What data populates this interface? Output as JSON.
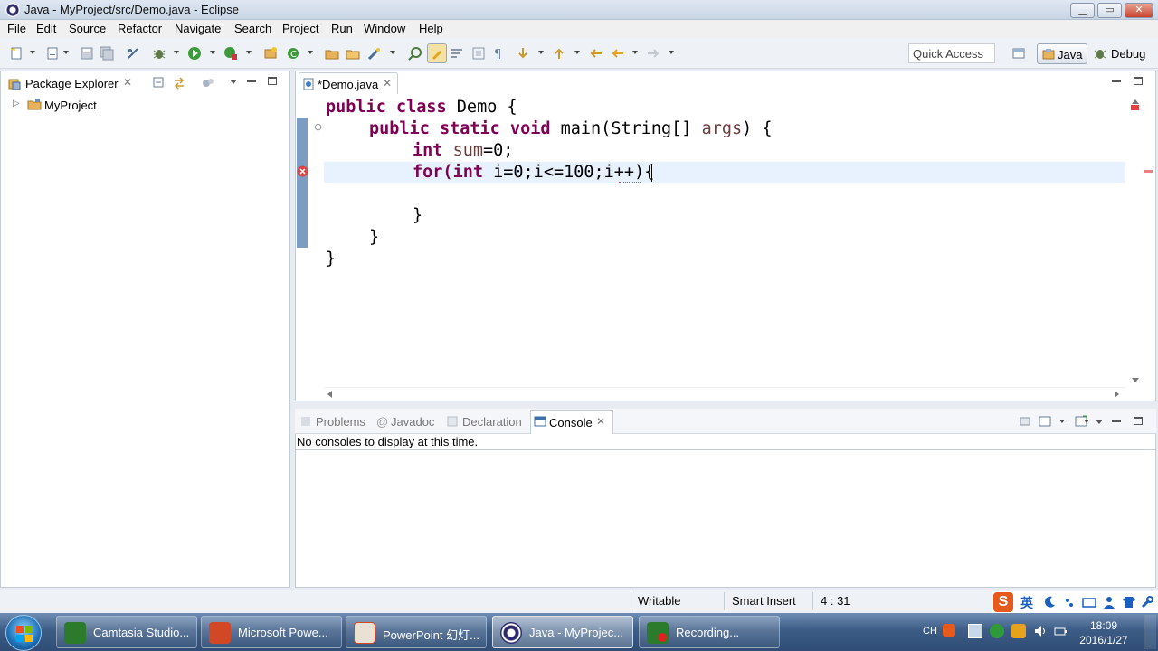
{
  "window": {
    "title": "Java - MyProject/src/Demo.java - Eclipse",
    "minimize": "▁",
    "maximize": "▭",
    "close": "✕"
  },
  "menu": [
    "File",
    "Edit",
    "Source",
    "Refactor",
    "Navigate",
    "Search",
    "Project",
    "Run",
    "Window",
    "Help"
  ],
  "toolbar": {
    "quick_access": "Quick Access",
    "perspective_java": "Java",
    "perspective_debug": "Debug"
  },
  "package_explorer": {
    "title": "Package Explorer",
    "close": "✕",
    "project": "MyProject",
    "expand": "▷"
  },
  "editor": {
    "tab_label": "*Demo.java",
    "close": "✕",
    "code_lines": [
      [
        "public class ",
        "Demo {"
      ],
      [
        "public static void ",
        "main(String[] ",
        "args",
        ") {"
      ],
      [
        "int ",
        "sum",
        "=0;"
      ],
      [
        "for(",
        "int ",
        "i=0;i<=100;i++){"
      ],
      [
        "}"
      ],
      [
        "}"
      ],
      [
        "}"
      ]
    ]
  },
  "bottom_panel": {
    "tabs": [
      "Problems",
      "Javadoc",
      "Declaration",
      "Console"
    ],
    "console_close": "✕",
    "message": "No consoles to display at this time."
  },
  "status_bar": {
    "mode": "Writable",
    "insert": "Smart Insert",
    "position": "4 : 31"
  },
  "ime": {
    "brand": "S",
    "lang": "英"
  },
  "taskbar": {
    "items": [
      "Camtasia Studio...",
      "Microsoft Powe...",
      "PowerPoint 幻灯...",
      "Java - MyProjec...",
      "Recording..."
    ],
    "lang": "CH",
    "time": "18:09",
    "date": "2016/1/27"
  },
  "colors": {
    "keyword": "#7f0055",
    "variable": "#6a3e3e",
    "error": "#e04343",
    "selection": "#e8f2fe"
  }
}
